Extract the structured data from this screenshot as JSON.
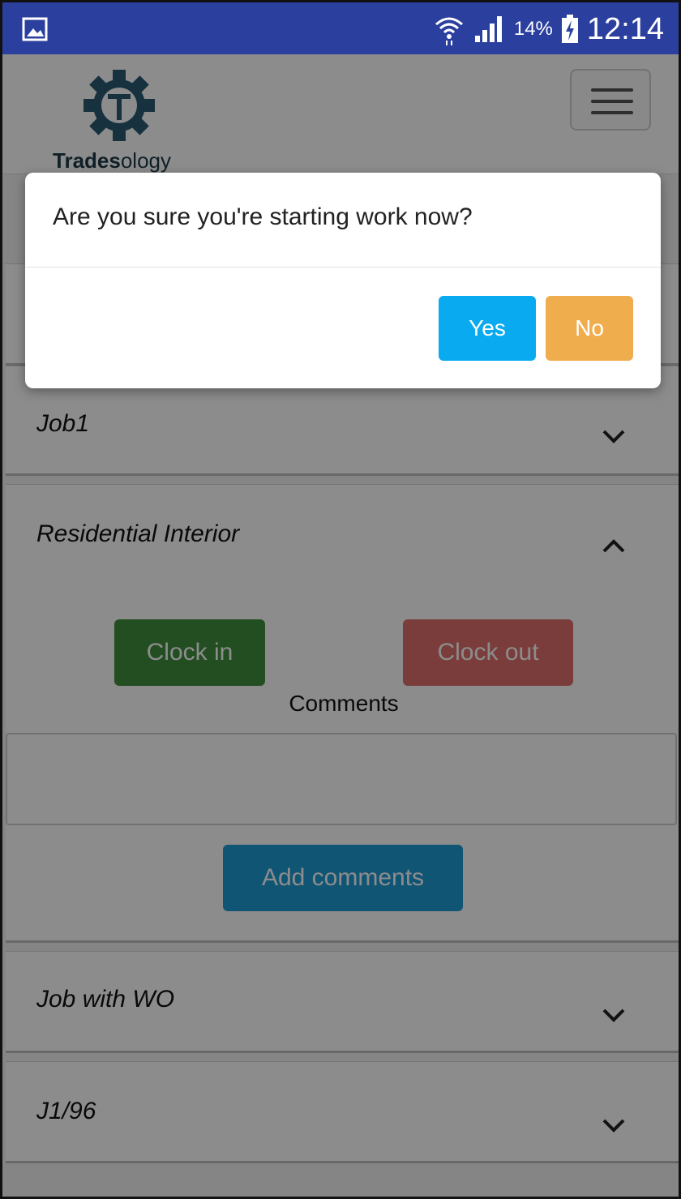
{
  "status_bar": {
    "battery_percent": "14%",
    "time": "12:14",
    "icons": [
      "image-icon",
      "wifi-icon",
      "signal-icon",
      "battery-charging-icon"
    ]
  },
  "header": {
    "logo_bold": "Trades",
    "logo_rest": "ology",
    "menu_icon": "hamburger-menu-icon"
  },
  "jobs": [
    {
      "title": "Job1",
      "expanded": false
    },
    {
      "title": "Residential Interior",
      "expanded": true
    },
    {
      "title": "Job with WO",
      "expanded": false
    },
    {
      "title": "J1/96",
      "expanded": false
    }
  ],
  "expanded_job": {
    "clock_in_label": "Clock in",
    "clock_out_label": "Clock out",
    "comments_label": "Comments",
    "comments_value": "",
    "add_comments_label": "Add comments"
  },
  "dialog": {
    "message": "Are you sure you're starting work now?",
    "yes_label": "Yes",
    "no_label": "No"
  },
  "colors": {
    "status_bar": "#2a3f9e",
    "clock_in": "#3f8f3f",
    "clock_out": "#d9534f",
    "add_comments": "#1f9bd6",
    "yes": "#0aaaf0",
    "no": "#f0ad4e"
  }
}
